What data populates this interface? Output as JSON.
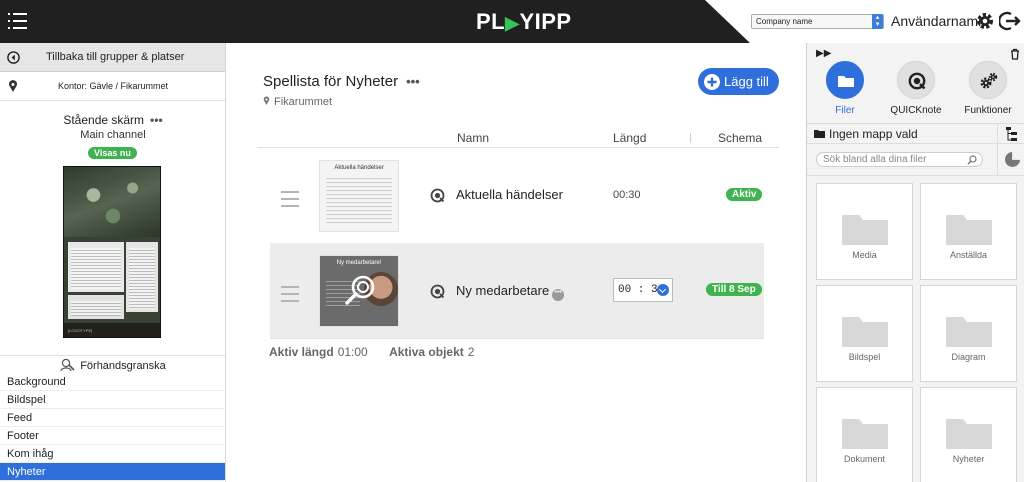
{
  "header": {
    "logo": "PLAYIPP",
    "company_select": "Company name",
    "username": "Användarnamn"
  },
  "left": {
    "back_label": "Tillbaka till grupper & platser",
    "office_label": "Kontor: Gävle / Fikarummet",
    "screen_title": "Stående skärm",
    "screen_channel": "Main channel",
    "live_badge": "Visas nu",
    "preview_footer": "[LOGOTYPE]",
    "preview_label": "Förhandsgranska",
    "channels": [
      "Background",
      "Bildspel",
      "Feed",
      "Footer",
      "Kom ihåg",
      "Nyheter"
    ],
    "active_channel": "Nyheter"
  },
  "main": {
    "title": "Spellista för Nyheter",
    "location": "Fikarummet",
    "add_button": "Lägg till",
    "columns": {
      "name": "Namn",
      "length": "Längd",
      "schedule": "Schema"
    },
    "items": [
      {
        "thumb_title": "Aktuella händelser",
        "name": "Aktuella händelser",
        "length": "00:30",
        "status": "Aktiv"
      },
      {
        "thumb_title": "Ny medarbetare!",
        "name": "Ny medarbetare",
        "length": "00 : 30",
        "status": "Till 8 Sep"
      }
    ],
    "stats": {
      "active_length_label": "Aktiv längd",
      "active_length_value": "01:00",
      "active_objects_label": "Aktiva objekt",
      "active_objects_value": "2"
    }
  },
  "right": {
    "tools": [
      {
        "label": "Filer",
        "icon": "folder-icon",
        "active": true
      },
      {
        "label": "QUICKnote",
        "icon": "quicknote-icon",
        "active": false
      },
      {
        "label": "Funktioner",
        "icon": "gears-icon",
        "active": false
      }
    ],
    "folder_label": "Ingen mapp vald",
    "search_placeholder": "Sök bland alla dina filer",
    "folders": [
      "Media",
      "Anställda",
      "Bildspel",
      "Diagram",
      "Dokument",
      "Nyheter"
    ]
  },
  "colors": {
    "accent": "#2f6fdc",
    "green": "#3fb34f",
    "topbar": "#202020"
  }
}
